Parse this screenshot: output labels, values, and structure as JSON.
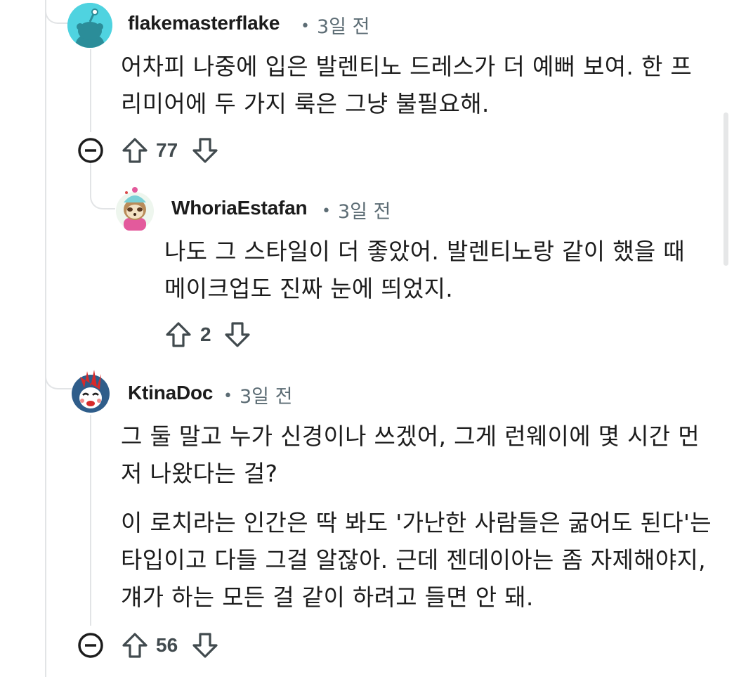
{
  "comments": [
    {
      "username": "flakemasterflake",
      "time": "3일 전",
      "lines": [
        "어차피 나중에 입은 발렌티노 드레스가 더 예뻐 보여. 한 프",
        "리미어에 두 가지 룩은 그냥 불필요해."
      ],
      "score": "77",
      "avatar_icon": "reddit-snoo-avatar",
      "avatar_color": "#4fd3e0"
    },
    {
      "username": "WhoriaEstafan",
      "time": "3일 전",
      "lines": [
        "나도 그 스타일이 더 좋았어. 발렌티노랑 같이 했을 때",
        "메이크업도 진짜 눈에 띄었지."
      ],
      "score": "2",
      "avatar_icon": "sloth-avatar",
      "avatar_color": "#d8c9a8"
    },
    {
      "username": "KtinaDoc",
      "time": "3일 전",
      "paragraph1": [
        "그 둘 말고 누가 신경이나 쓰겠어, 그게 런웨이에 몇 시간 먼",
        "저 나왔다는 걸?"
      ],
      "paragraph2": [
        "이 로치라는 인간은 딱 봐도 '가난한 사람들은 굶어도 된다'는",
        "타입이고 다들 그걸 알잖아. 근데 젠데이아는 좀 자제해야지,",
        "걔가 하는 모든 걸 같이 하려고 들면 안 돼."
      ],
      "score": "56",
      "avatar_icon": "punk-mohawk-avatar",
      "avatar_color": "#d72a2a"
    }
  ],
  "separator": "•",
  "icons": {
    "collapse": "collapse-thread-icon",
    "upvote": "upvote-arrow-icon",
    "downvote": "downvote-arrow-icon"
  },
  "colors": {
    "thread_line": "#e2e4e6",
    "meta_text": "#5c6c74",
    "score_text": "#414a4e"
  }
}
